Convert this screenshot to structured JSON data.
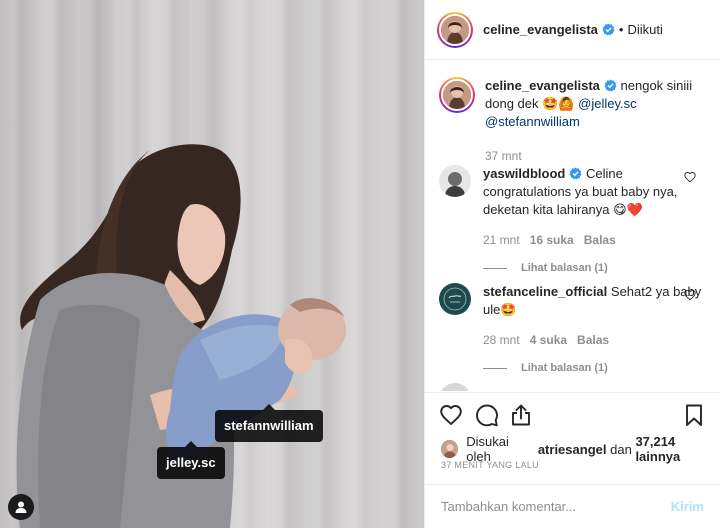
{
  "post": {
    "tags": {
      "stefan": "stefannwilliam",
      "jelley": "jelley.sc"
    }
  },
  "header": {
    "username": "celine_evangelista",
    "separator": "•",
    "follow_state": "Diikuti"
  },
  "caption": {
    "username": "celine_evangelista",
    "text_before": "nengok siniii dong dek",
    "emoji": "🤩🙆",
    "mention1": "@jelley.sc",
    "mention2": "@stefannwilliam",
    "time": "37 mnt"
  },
  "comments": [
    {
      "username": "yaswildblood",
      "text": "Celine congratulations ya buat baby nya, deketan kita lahiranya 😋❤️",
      "time": "21 mnt",
      "likes": "16 suka",
      "reply_label": "Balas",
      "view_replies": "Lihat balasan (1)"
    },
    {
      "username": "stefanceline_official",
      "text": "Sehat2 ya baby ule🤩",
      "time": "28 mnt",
      "likes": "4 suka",
      "reply_label": "Balas",
      "view_replies": "Lihat balasan (1)"
    }
  ],
  "likes_line": {
    "prefix": "Disukai oleh",
    "user": "atriesangel",
    "conjunction": "dan",
    "count": "37,214 lainnya"
  },
  "timestamp": "37 MENIT YANG LALU",
  "add_comment": {
    "placeholder": "Tambahkan komentar...",
    "post_label": "Kirim"
  },
  "icons": [
    "verified-badge-icon",
    "heart-icon",
    "comment-icon",
    "share-icon",
    "bookmark-icon",
    "user-tag-icon"
  ],
  "colors": {
    "link": "#003569",
    "verified": "#3897f0",
    "muted": "#8e8e8e",
    "post_disabled": "#b2dffc"
  }
}
